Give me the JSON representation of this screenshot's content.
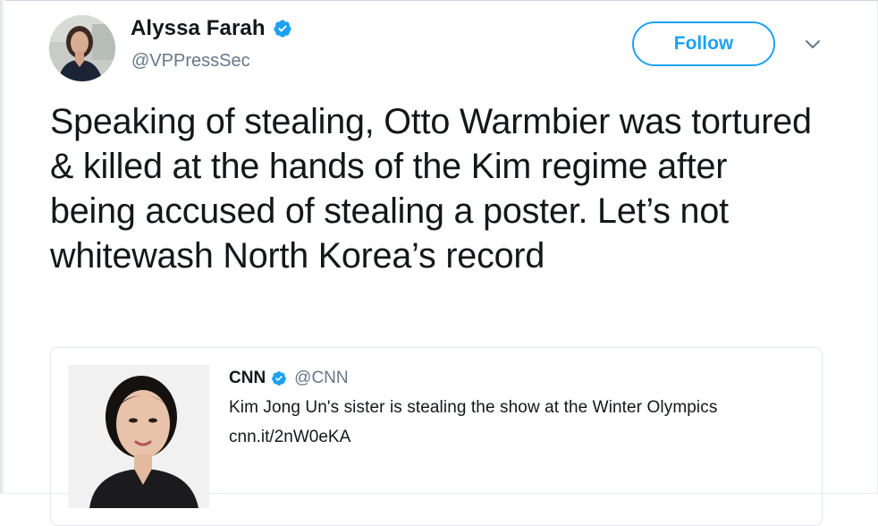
{
  "tweet": {
    "author": {
      "display_name": "Alyssa Farah",
      "handle": "@VPPressSec",
      "verified": true
    },
    "follow_label": "Follow",
    "menu_icon": "chevron-down-icon",
    "text": "Speaking of stealing, Otto Warmbier was tortured & killed at the hands of the Kim regime after being accused of stealing a poster. Let’s not whitewash North Korea’s record"
  },
  "quoted_tweet": {
    "author": {
      "display_name": "CNN",
      "handle": "@CNN",
      "verified": true
    },
    "text": "Kim Jong Un's sister is stealing the show at the Winter Olympics",
    "link": "cnn.it/2nW0eKA"
  },
  "colors": {
    "accent": "#1da1f2",
    "text_primary": "#14171a",
    "text_secondary": "#657786",
    "border": "#e1e8ed"
  }
}
